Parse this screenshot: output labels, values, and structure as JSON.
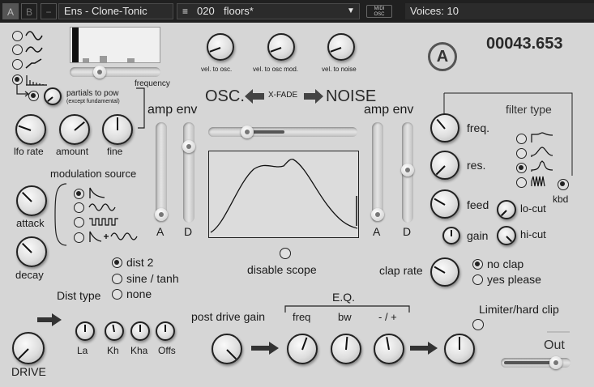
{
  "topbar": {
    "a_button": "A",
    "b_button": "B",
    "minus_button": "−",
    "instrument_name": "Ens - Clone-Tonic",
    "preset_icon": "list-icon",
    "preset_number": "020",
    "preset_name": "floors*",
    "midi_osc_line1": "MIDI",
    "midi_osc_line2": "OSC",
    "voices": "Voices: 10"
  },
  "lfo": {
    "frequency_label": "frequency",
    "partials_label": "partials to pow",
    "partials_sublabel": "(except fundamental)",
    "lfo_rate_label": "lfo rate",
    "amount_label": "amount",
    "fine_label": "fine",
    "waveforms": [
      "sine",
      "triangle",
      "saw",
      "harmonics"
    ]
  },
  "velocity": {
    "vel_osc": "vel. to osc.",
    "vel_osc_mod": "vel. to osc mod.",
    "vel_noise": "vel. to noise"
  },
  "display": {
    "logo": "A",
    "value": "00043.653"
  },
  "xfade": {
    "osc_label": "OSC.",
    "xfade_label": "X-FADE",
    "noise_label": "NOISE",
    "disable_scope": "disable scope"
  },
  "amp_env_left": {
    "title": "amp env",
    "a": "A",
    "d": "D"
  },
  "amp_env_right": {
    "title": "amp env",
    "a": "A",
    "d": "D"
  },
  "modulation": {
    "title": "modulation source",
    "attack": "attack",
    "decay": "decay"
  },
  "filter": {
    "title": "filter type",
    "freq": "freq.",
    "res": "res.",
    "feed": "feed",
    "lo_cut": "lo-cut",
    "gain": "gain",
    "hi_cut": "hi-cut",
    "kbd": "kbd"
  },
  "dist": {
    "title": "Dist type",
    "options": [
      "dist 2",
      "sine / tanh",
      "none"
    ],
    "la": "La",
    "kh": "Kh",
    "kha": "Kha",
    "offs": "Offs",
    "drive": "DRIVE"
  },
  "clap": {
    "label": "clap rate",
    "no_clap": "no clap",
    "yes_please": "yes please"
  },
  "eq": {
    "title": "E.Q.",
    "post_drive_gain": "post drive gain",
    "freq": "freq",
    "bw": "bw",
    "minus_plus": "- / +"
  },
  "output": {
    "limiter": "Limiter/hard clip",
    "out": "Out"
  },
  "colors": {
    "panel": "#d6d6d6",
    "topbar": "#202020",
    "ink": "#1a1a1a"
  }
}
